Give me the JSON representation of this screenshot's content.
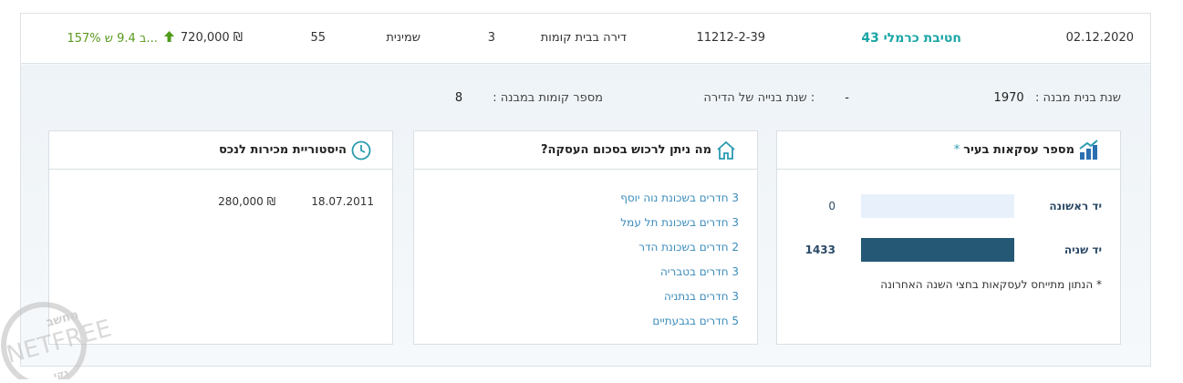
{
  "header": {
    "date": "02.12.2020",
    "neighborhood": "חטיבת כרמלי 43",
    "gush_helka": "11212-2-39",
    "property_type": "דירה בבית קומות",
    "rooms": "3",
    "floor": "שמינית",
    "area": "55",
    "price": "720,000 ₪",
    "change": "157% ב 9.4 ש...",
    "change_icon": "arrow-up-icon"
  },
  "building_info": {
    "year_label": "שנת בנית מבנה :",
    "year_value": "1970",
    "apt_year_label": "שנת בנייה של הדירה :",
    "apt_year_value": "-",
    "floors_label": "מספר קומות במבנה :",
    "floors_value": "8"
  },
  "transactions_card": {
    "title": "מספר עסקאות בעיר",
    "star": "*",
    "icon": "bar-chart-icon",
    "note": "* הנתון מתייחס לעסקאות בחצי השנה האחרונה"
  },
  "chart_data": {
    "type": "bar",
    "orientation": "horizontal",
    "categories": [
      "יד ראשונה",
      "יד שניה"
    ],
    "values": [
      0,
      1433
    ],
    "value_labels": [
      "0",
      "1433"
    ],
    "colors": [
      "#e8f1fb",
      "#245874"
    ]
  },
  "buy_card": {
    "title": "מה ניתן לרכוש בסכום העסקה?",
    "icon": "home-icon",
    "items": [
      "3 חדרים בשכונת נוה יוסף",
      "3 חדרים בשכונת תל עמל",
      "2 חדרים בשכונת הדר",
      "3 חדרים בטבריה",
      "3 חדרים בנתניה",
      "5 חדרים בגבעתיים"
    ]
  },
  "history_card": {
    "title": "היסטוריית מכירות לנכס",
    "icon": "clock-icon",
    "rows": [
      {
        "date": "18.07.2011",
        "price": "280,000 ₪"
      }
    ]
  },
  "watermark": {
    "brand": "NETFREE",
    "top_text": "מחשב",
    "bottom_text": "נקי"
  }
}
